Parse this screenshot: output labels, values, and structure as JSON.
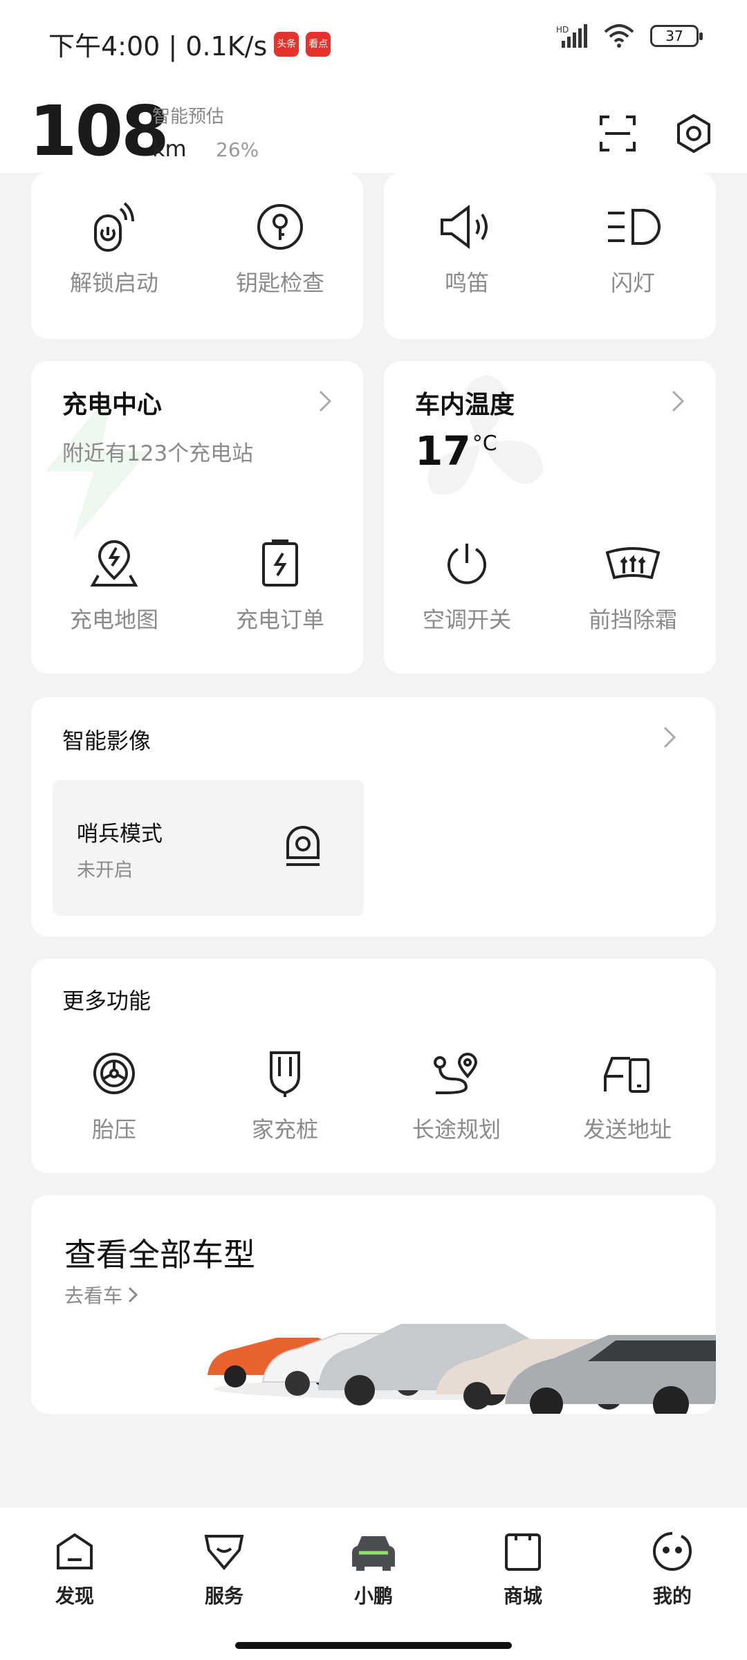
{
  "status": {
    "time": "下午4:00 | 0.1K/s",
    "app1": "头条",
    "app2": "看点",
    "battery": "37"
  },
  "header": {
    "range": "108",
    "range_label": "智能预估",
    "unit": "km",
    "percent": "26%"
  },
  "controls": [
    {
      "label": "解锁启动",
      "icon": "remote-start-icon"
    },
    {
      "label": "钥匙检查",
      "icon": "key-icon"
    },
    {
      "label": "鸣笛",
      "icon": "horn-icon"
    },
    {
      "label": "闪灯",
      "icon": "headlight-icon"
    }
  ],
  "charging": {
    "title": "充电中心",
    "subtitle": "附近有123个充电站",
    "actions": [
      "充电地图",
      "充电订单"
    ]
  },
  "climate": {
    "title": "车内温度",
    "temp": "17",
    "unit": "°C",
    "actions": [
      "空调开关",
      "前挡除霜"
    ]
  },
  "imaging": {
    "title": "智能影像",
    "sentry_title": "哨兵模式",
    "sentry_status": "未开启"
  },
  "more": {
    "title": "更多功能",
    "items": [
      "胎压",
      "家充桩",
      "长途规划",
      "发送地址"
    ]
  },
  "models": {
    "title": "查看全部车型",
    "link": "去看车"
  },
  "tabs": [
    "发现",
    "服务",
    "小鹏",
    "商城",
    "我的"
  ],
  "colors": {
    "accent": "#8ee06a",
    "text": "#1a1a1a",
    "muted": "#8a8a8a",
    "bg": "#f2f3f5"
  }
}
